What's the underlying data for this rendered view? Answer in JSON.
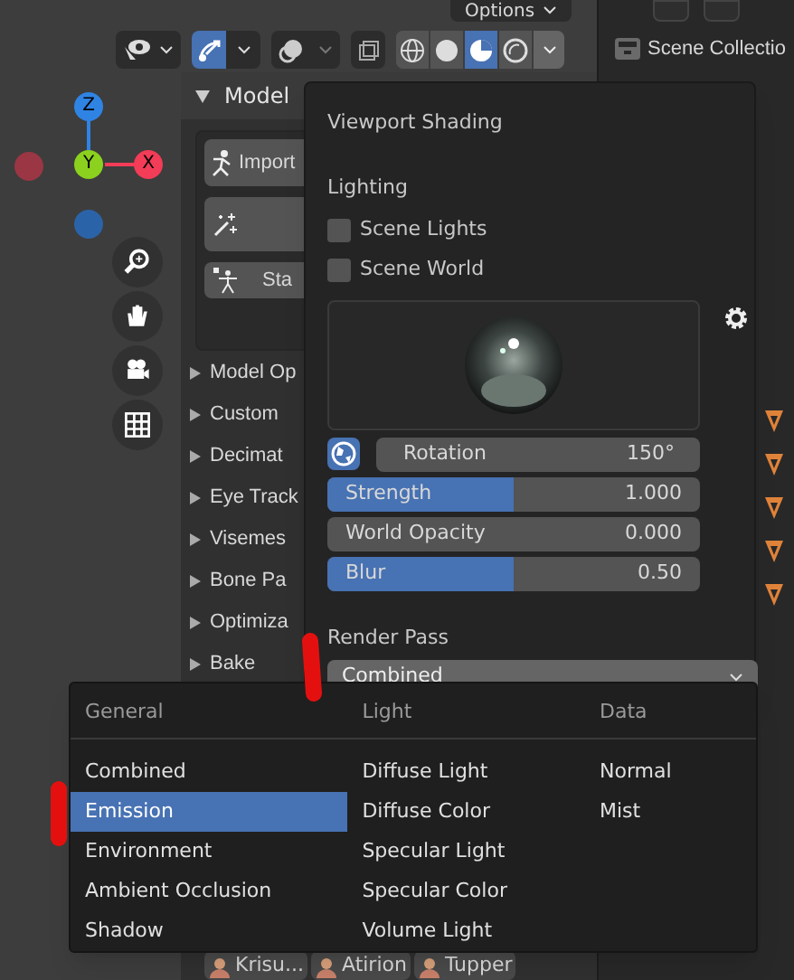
{
  "header": {
    "options_label": "Options"
  },
  "shading_modes": [
    {
      "kind": "wireframe",
      "selected": false
    },
    {
      "kind": "solid",
      "selected": false
    },
    {
      "kind": "material",
      "selected": true
    },
    {
      "kind": "rendered",
      "selected": false
    }
  ],
  "gizmo": {
    "z": "Z",
    "y": "Y",
    "x": "X"
  },
  "panel": {
    "title": "Model",
    "import_label": "Import",
    "start_label": "Sta",
    "sections": [
      "Model Op",
      "Custom",
      "Decimat",
      "Eye Track",
      "Visemes",
      "Bone Pa",
      "Optimiza",
      "Bake"
    ]
  },
  "outliner": {
    "title": "Scene Collectio"
  },
  "shading_popover": {
    "title": "Viewport Shading",
    "lighting_label": "Lighting",
    "options": [
      {
        "label": "Scene Lights",
        "checked": false
      },
      {
        "label": "Scene World",
        "checked": false
      }
    ],
    "rotation": {
      "label": "Rotation",
      "value": "150°"
    },
    "sliders": [
      {
        "label": "Strength",
        "value": "1.000",
        "level": 0.5
      },
      {
        "label": "World Opacity",
        "value": "0.000",
        "level": 0
      },
      {
        "label": "Blur",
        "value": "0.50",
        "level": 0.5
      }
    ],
    "render_pass_label": "Render Pass",
    "render_pass": "Combined"
  },
  "render_pass_menu": [
    {
      "heading": "General",
      "items": [
        {
          "label": "Combined",
          "selected": false
        },
        {
          "label": "Emission",
          "selected": true
        },
        {
          "label": "Environment",
          "selected": false
        },
        {
          "label": "Ambient Occlusion",
          "selected": false
        },
        {
          "label": "Shadow",
          "selected": false
        }
      ]
    },
    {
      "heading": "Light",
      "items": [
        {
          "label": "Diffuse Light",
          "selected": false
        },
        {
          "label": "Diffuse Color",
          "selected": false
        },
        {
          "label": "Specular Light",
          "selected": false
        },
        {
          "label": "Specular Color",
          "selected": false
        },
        {
          "label": "Volume Light",
          "selected": false
        }
      ]
    },
    {
      "heading": "Data",
      "items": [
        {
          "label": "Normal",
          "selected": false
        },
        {
          "label": "Mist",
          "selected": false
        }
      ]
    }
  ],
  "supporters": [
    "Krisu...",
    "Atirion",
    "Tupper"
  ]
}
